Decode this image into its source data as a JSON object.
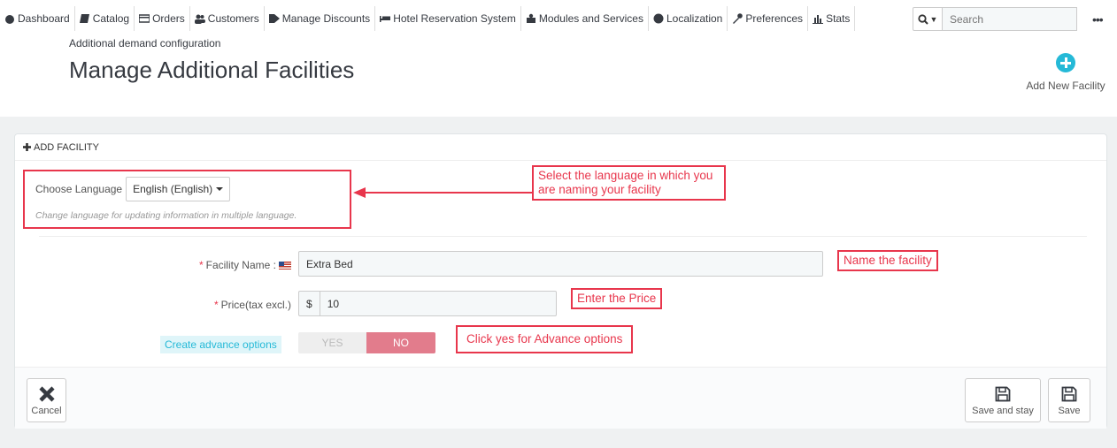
{
  "nav": [
    {
      "label": "Dashboard",
      "icon": "dashboard-icon"
    },
    {
      "label": "Catalog",
      "icon": "book-icon"
    },
    {
      "label": "Orders",
      "icon": "credit-card-icon"
    },
    {
      "label": "Customers",
      "icon": "users-icon"
    },
    {
      "label": "Manage Discounts",
      "icon": "tag-icon"
    },
    {
      "label": "Hotel Reservation System",
      "icon": "bed-icon"
    },
    {
      "label": "Modules and Services",
      "icon": "puzzle-icon"
    },
    {
      "label": "Localization",
      "icon": "globe-icon"
    },
    {
      "label": "Preferences",
      "icon": "wrench-icon"
    },
    {
      "label": "Stats",
      "icon": "bar-chart-icon"
    }
  ],
  "search": {
    "placeholder": "Search"
  },
  "header": {
    "breadcrumb": "Additional demand configuration",
    "title": "Manage Additional Facilities",
    "add_new_label": "Add New Facility"
  },
  "panel": {
    "heading": "ADD FACILITY",
    "language": {
      "label": "Choose Language",
      "selected": "English (English)",
      "help": "Change language for updating information in multiple language."
    },
    "facility_name": {
      "label": "Facility Name :",
      "value": "Extra Bed"
    },
    "price": {
      "label": "Price(tax excl.)",
      "currency": "$",
      "value": "10"
    },
    "advance": {
      "label": "Create advance options",
      "yes": "YES",
      "no": "NO",
      "selected": "NO"
    },
    "footer": {
      "cancel": "Cancel",
      "save_and_stay": "Save and stay",
      "save": "Save"
    }
  },
  "annotations": {
    "language": "Select the language in which you are naming your facility",
    "name": "Name the facility",
    "price": "Enter the Price",
    "advance": "Click yes for Advance options"
  },
  "colors": {
    "accent": "#25b9d7",
    "annotation": "#e8364c",
    "no_toggle": "#e27c8c"
  }
}
